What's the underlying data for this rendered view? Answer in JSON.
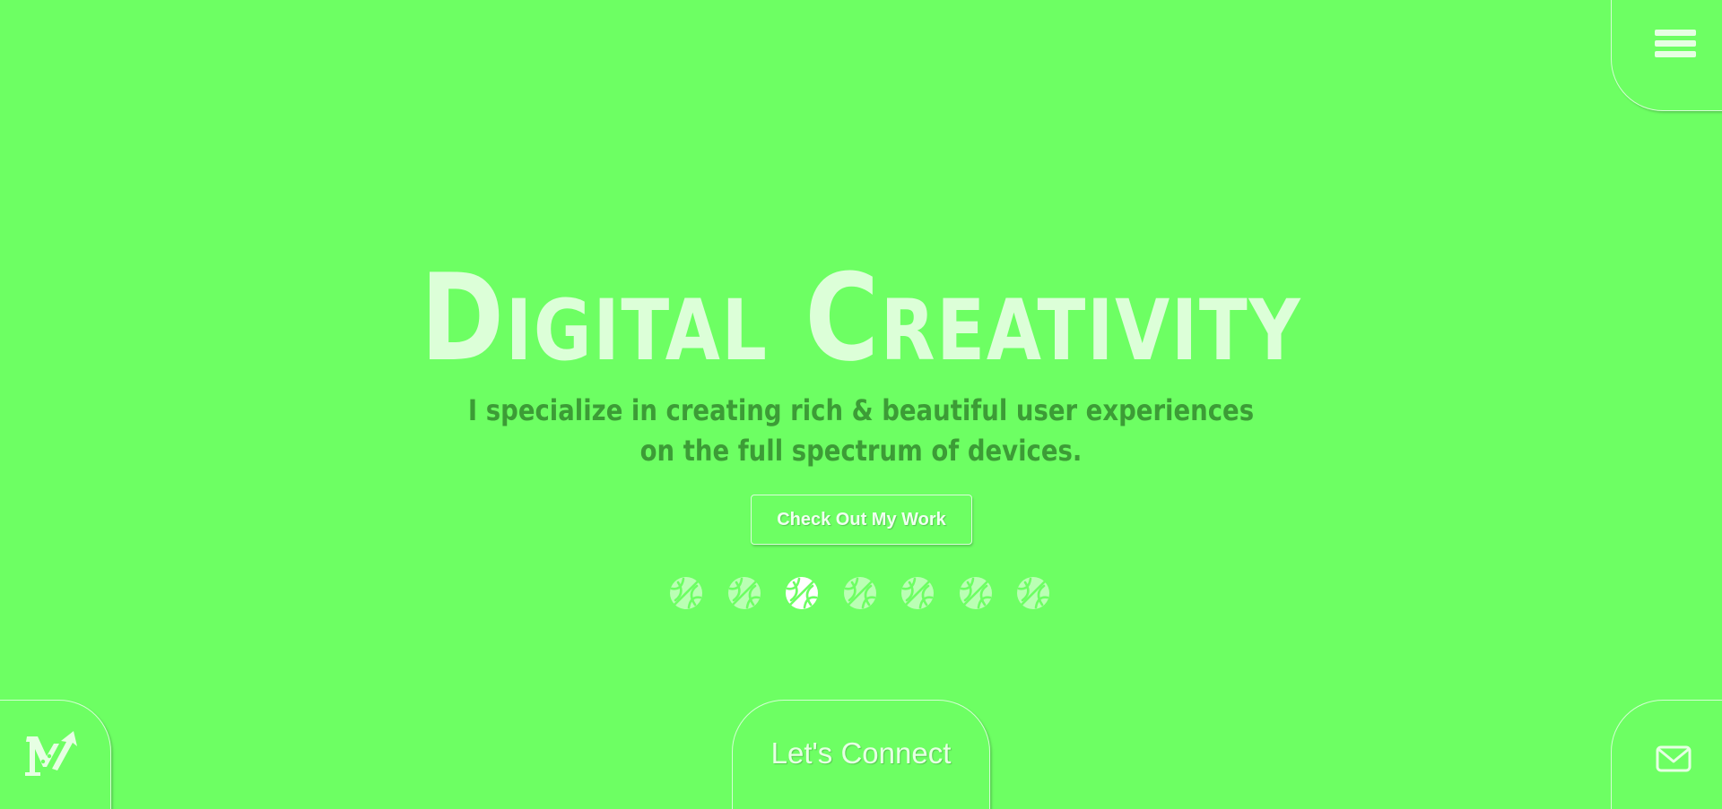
{
  "hero": {
    "title": "Digital Creativity",
    "subtitle_line1": "I specialize in creating rich & beautiful user experiences",
    "subtitle_line2": "on the full spectrum of devices.",
    "cta_label": "Check Out My Work"
  },
  "connect": {
    "label": "Let's Connect"
  },
  "slider": {
    "count": 7,
    "active_index": 2
  },
  "icons": {
    "menu": "menu-icon",
    "logo": "logo-icon",
    "mail": "mail-icon",
    "dot": "basketball-icon"
  },
  "colors": {
    "background": "#6dff63",
    "title": "#dcffd8",
    "subtitle": "#3c9c36",
    "light": "#e6ffe3",
    "active_dot": "#ffffff"
  }
}
